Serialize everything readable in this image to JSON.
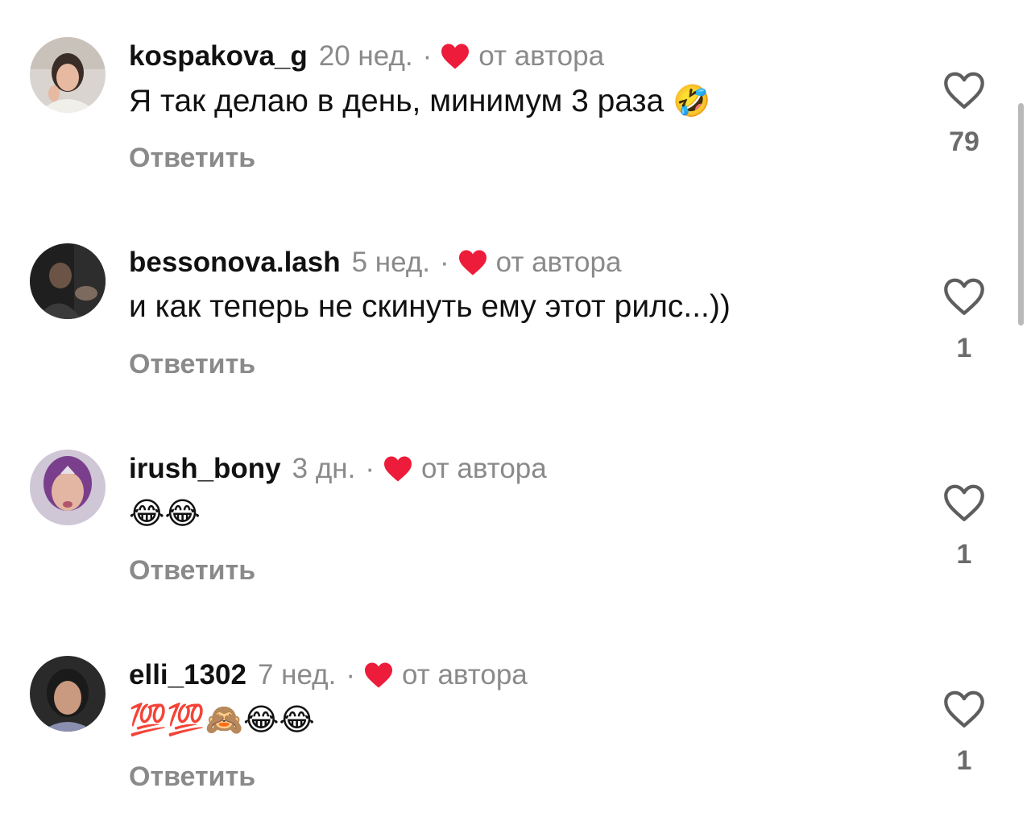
{
  "colors": {
    "author_heart": "#ed1c3a",
    "muted_text": "#8a8a8a",
    "text": "#111111"
  },
  "labels": {
    "from_author": "от автора",
    "reply": "Ответить",
    "separator": "·"
  },
  "comments": [
    {
      "username": "kospakova_g",
      "time": "20 нед.",
      "text": "Я так делаю в день, минимум 3 раза",
      "emoji": "🤣",
      "likes": "79"
    },
    {
      "username": "bessonova.lash",
      "time": "5 нед.",
      "text": "и как теперь не скинуть ему этот рилс...))",
      "emoji": "",
      "likes": "1"
    },
    {
      "username": "irush_bony",
      "time": "3 дн.",
      "text": "",
      "emoji": "😂😂",
      "likes": "1"
    },
    {
      "username": "elli_1302",
      "time": "7 нед.",
      "text": "",
      "emoji": "💯💯🙈😂😂",
      "likes": "1"
    }
  ]
}
